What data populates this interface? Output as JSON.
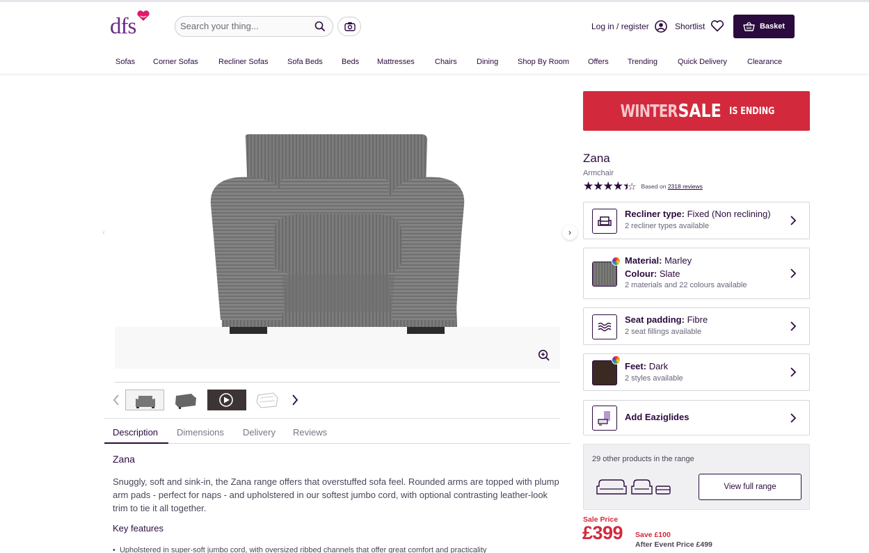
{
  "brand": {
    "logo_text": "dfs"
  },
  "search": {
    "placeholder": "Search your thing..."
  },
  "header": {
    "login_label": "Log in / register",
    "shortlist_label": "Shortlist",
    "basket_label": "Basket"
  },
  "nav": {
    "items": [
      "Sofas",
      "Corner Sofas",
      "Recliner Sofas",
      "Sofa Beds",
      "Beds",
      "Mattresses",
      "Chairs",
      "Dining",
      "Shop By Room",
      "Offers",
      "Trending",
      "Quick Delivery",
      "Clearance"
    ]
  },
  "promo": {
    "part1": "WINTER",
    "part2": "SALE",
    "part3": "IS ENDING"
  },
  "product": {
    "name": "Zana",
    "type": "Armchair",
    "rating": 4.5,
    "reviews_prefix": "Based on",
    "reviews_link": "2318 reviews"
  },
  "options": {
    "recliner": {
      "label": "Recliner type:",
      "value": "Fixed (Non reclining)",
      "sub": "2 recliner types available"
    },
    "material": {
      "label": "Material:",
      "value": "Marley",
      "colour_label": "Colour:",
      "colour_value": "Slate",
      "sub": "2 materials and 22 colours available"
    },
    "padding": {
      "label": "Seat padding:",
      "value": "Fibre",
      "sub": "2 seat fillings available"
    },
    "feet": {
      "label": "Feet:",
      "value": "Dark",
      "sub": "2 styles available"
    },
    "eaziglides": {
      "label": "Add Eaziglides"
    }
  },
  "range": {
    "text": "29 other products in the range",
    "button_label": "View full range"
  },
  "price": {
    "sale_label": "Sale Price",
    "current": "£399",
    "save": "Save £100",
    "after_event": "After Event Price £499"
  },
  "tabs": [
    "Description",
    "Dimensions",
    "Delivery",
    "Reviews"
  ],
  "description": {
    "title": "Zana",
    "body": "Snuggly, soft and sink-in, the Zana range offers that overstuffed sofa feel. Rounded arms are topped with plump arm pads - perfect for naps - and upholstered in our softest jumbo cord, with optional contrasting leather-look trim to tie it all together.",
    "key_features_title": "Key features",
    "key_features": [
      "Upholstered in super-soft jumbo cord, with oversized ribbed channels that offer great comfort and practicality"
    ]
  },
  "colors": {
    "brand": "#2b0a3d",
    "sale": "#d22a3c",
    "logo": "#6b2a8a"
  }
}
